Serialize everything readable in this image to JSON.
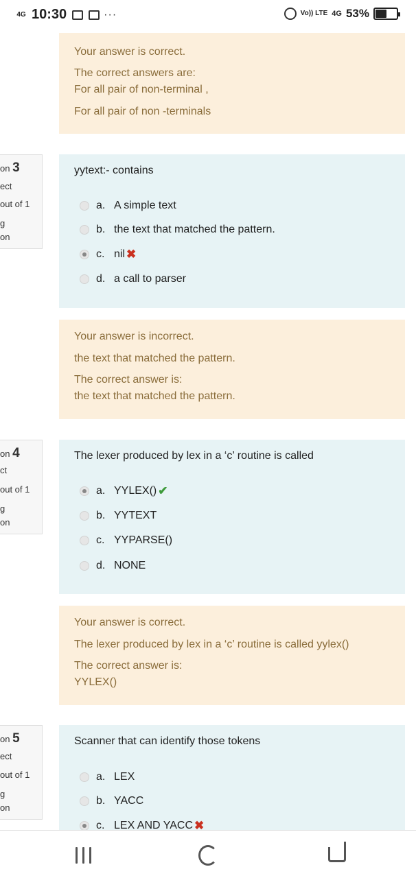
{
  "status_bar": {
    "network": "4G",
    "time": "10:30",
    "more": "···",
    "volte": "Vo)) LTE",
    "network_right": "4G",
    "battery_percent": "53%",
    "battery_level": 0.53
  },
  "feedback_1": {
    "result": "Your answer is correct.",
    "label": "The correct answers are:",
    "answer_a": "For all pair of non-terminal ,",
    "answer_b": "For all pair of non -terminals"
  },
  "question_3": {
    "info": {
      "label": "on",
      "number": "3",
      "state": "ect",
      "marks": "out of 1",
      "flag": "g",
      "flag_label": "on"
    },
    "text": "yytext:- contains",
    "options": [
      {
        "letter": "a.",
        "text": "A simple text",
        "selected": false,
        "mark": ""
      },
      {
        "letter": "b.",
        "text": "the text that matched the pattern.",
        "selected": false,
        "mark": ""
      },
      {
        "letter": "c.",
        "text": "nil",
        "selected": true,
        "mark": "✖"
      },
      {
        "letter": "d.",
        "text": "a call to parser",
        "selected": false,
        "mark": ""
      }
    ]
  },
  "feedback_3": {
    "result": "Your answer is incorrect.",
    "general": "the text that matched the pattern.",
    "label": "The correct answer is:",
    "answer": "the text that matched the pattern."
  },
  "question_4": {
    "info": {
      "label": "on",
      "number": "4",
      "state": "ct",
      "marks": "out of 1",
      "flag": "g",
      "flag_label": "on"
    },
    "text": "The lexer produced by lex in a ‘c’ routine is called",
    "options": [
      {
        "letter": "a.",
        "text": "YYLEX()",
        "selected": true,
        "mark": "✔"
      },
      {
        "letter": "b.",
        "text": "YYTEXT",
        "selected": false,
        "mark": ""
      },
      {
        "letter": "c.",
        "text": "YYPARSE()",
        "selected": false,
        "mark": ""
      },
      {
        "letter": "d.",
        "text": "NONE",
        "selected": false,
        "mark": ""
      }
    ]
  },
  "feedback_4": {
    "result": "Your answer is correct.",
    "general": "The lexer produced by lex in a ‘c’ routine is called yylex()",
    "label": "The correct answer is:",
    "answer": "YYLEX()"
  },
  "question_5": {
    "info": {
      "label": "on",
      "number": "5",
      "state": "ect",
      "marks": "out of 1",
      "flag": "g",
      "flag_label": "on"
    },
    "text": "Scanner that can identify those tokens",
    "options": [
      {
        "letter": "a.",
        "text": "LEX",
        "selected": false,
        "mark": ""
      },
      {
        "letter": "b.",
        "text": "YACC",
        "selected": false,
        "mark": ""
      },
      {
        "letter": "c.",
        "text": "LEX AND YACC",
        "selected": true,
        "mark": "✖"
      }
    ]
  },
  "colors": {
    "feedback_bg": "#fcefdc",
    "feedback_text": "#8a6d3b",
    "question_bg": "#e7f3f5",
    "wrong": "#ca3120",
    "right": "#3d9a3a"
  }
}
